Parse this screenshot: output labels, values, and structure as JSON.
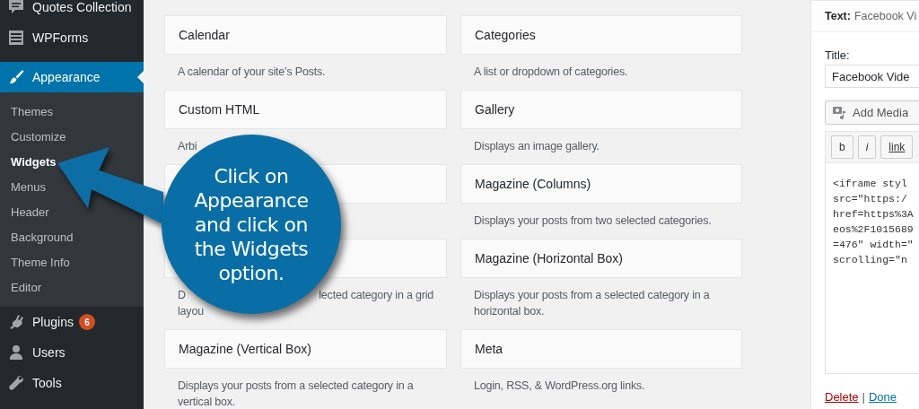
{
  "sidebar": {
    "items": [
      {
        "label": "Quotes Collection",
        "selected": false
      },
      {
        "label": "WPForms",
        "selected": false
      },
      {
        "label": "Appearance",
        "selected": true,
        "submenu": [
          {
            "label": "Themes",
            "selected": false
          },
          {
            "label": "Customize",
            "selected": false
          },
          {
            "label": "Widgets",
            "selected": true
          },
          {
            "label": "Menus",
            "selected": false
          },
          {
            "label": "Header",
            "selected": false
          },
          {
            "label": "Background",
            "selected": false
          },
          {
            "label": "Theme Info",
            "selected": false
          },
          {
            "label": "Editor",
            "selected": false
          }
        ]
      },
      {
        "label": "Plugins",
        "selected": false,
        "badge": "6"
      },
      {
        "label": "Users",
        "selected": false
      },
      {
        "label": "Tools",
        "selected": false
      }
    ]
  },
  "widget_columns": [
    {
      "widgets": [
        {
          "kind": "full",
          "title": "Calendar",
          "description": "A calendar of your site’s Posts."
        },
        {
          "kind": "full",
          "title": "Custom HTML",
          "description": "Arbi"
        },
        {
          "kind": "covered"
        },
        {
          "kind": "covered",
          "description_lines": [
            {
              "start": "D",
              "end": "lected category in a grid"
            },
            {
              "start": "layou"
            }
          ]
        },
        {
          "kind": "full",
          "title": "Magazine (Vertical Box)",
          "description": "Displays your posts from a selected category in a vertical box."
        }
      ]
    },
    {
      "widgets": [
        {
          "kind": "full",
          "title": "Categories",
          "description": "A list or dropdown of categories."
        },
        {
          "kind": "full",
          "title": "Gallery",
          "description": "Displays an image gallery."
        },
        {
          "kind": "full",
          "title": "Magazine (Columns)",
          "description": "Displays your posts from two selected categories."
        },
        {
          "kind": "full",
          "title": "Magazine (Horizontal Box)",
          "description": "Displays your posts from a selected category in a horizontal box."
        },
        {
          "kind": "full",
          "title": "Meta",
          "description": "Login, RSS, & WordPress.org links."
        }
      ]
    }
  ],
  "panel": {
    "label": "Text:",
    "widget_name": "Facebook Vi",
    "title_label": "Title:",
    "title_value": "Facebook Vide",
    "add_media": "Add Media",
    "toolbar": [
      "b",
      "i",
      "link"
    ],
    "code_lines": [
      "<iframe styl",
      "src=\"https:/",
      "href=https%3A",
      "eos%2F1015689",
      "=476\" width=\"",
      "scrolling=\"n"
    ],
    "delete": "Delete",
    "separator": "|",
    "done": "Done"
  },
  "callout": {
    "text": "Click on\nAppearance\nand click on\nthe Widgets\noption."
  }
}
